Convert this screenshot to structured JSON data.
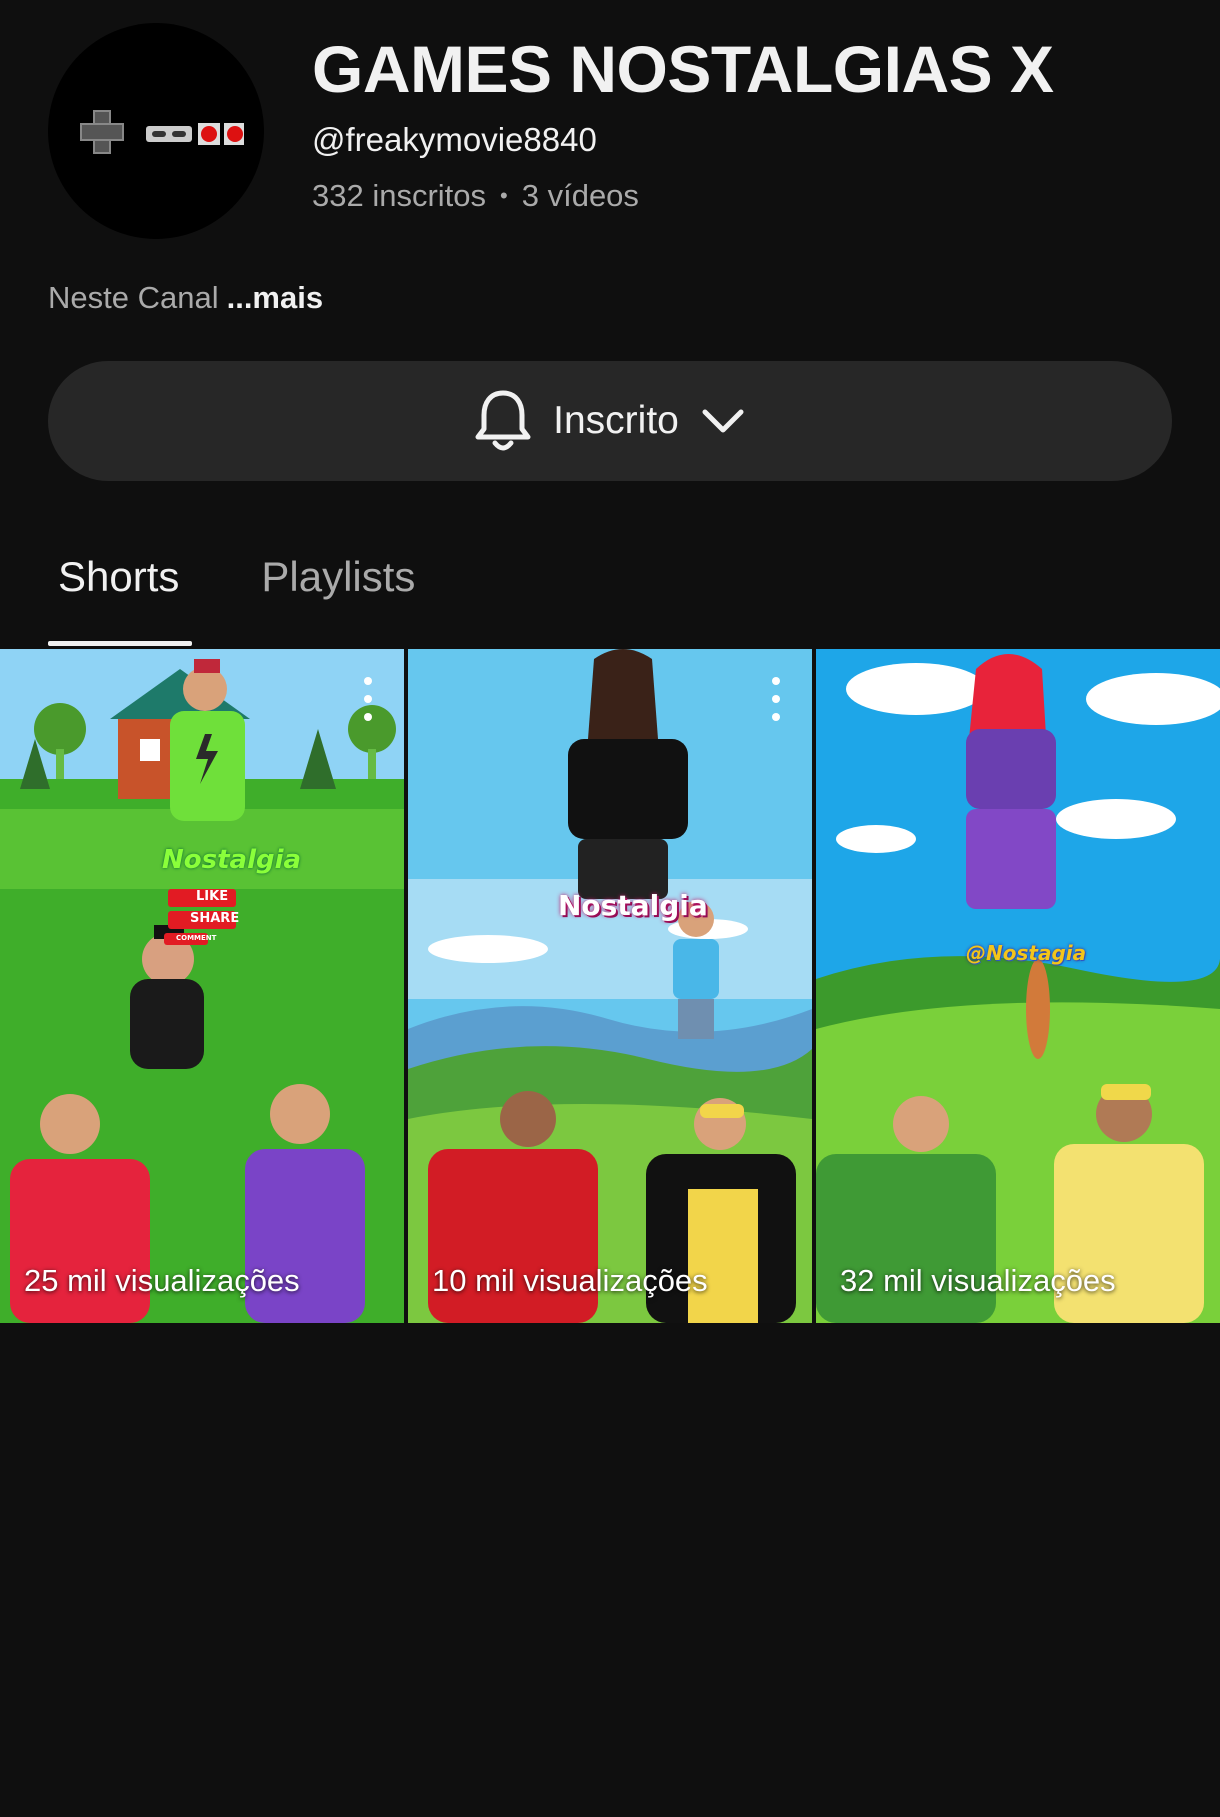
{
  "channel": {
    "name": "GAMES NOSTALGIAS X",
    "handle": "@freakymovie8840",
    "subscribers": "332 inscritos",
    "separator": "•",
    "videos": "3 vídeos",
    "description": "Neste Canal",
    "more_label": "...mais",
    "avatar_icon": "gamepad-icon"
  },
  "subscribe_button": {
    "label": "Inscrito",
    "icon": "bell-icon",
    "chevron": "chevron-down-icon"
  },
  "tabs": [
    {
      "label": "Shorts",
      "active": true
    },
    {
      "label": "Playlists",
      "active": false
    }
  ],
  "shorts": [
    {
      "views": "25 mil visualizações",
      "overlay_title": "Nostalgia",
      "like_label": "LIKE",
      "share_label": "SHARE",
      "comment_label": "COMMENT"
    },
    {
      "views": "10 mil visualizações",
      "overlay_title": "Nostalgia"
    },
    {
      "views": "32 mil visualizações",
      "overlay_title": "@Nostagia"
    }
  ],
  "colors": {
    "background": "#0f0f0f",
    "button_bg": "#272727",
    "text_primary": "#f1f1f1",
    "text_secondary": "#aaaaaa"
  }
}
